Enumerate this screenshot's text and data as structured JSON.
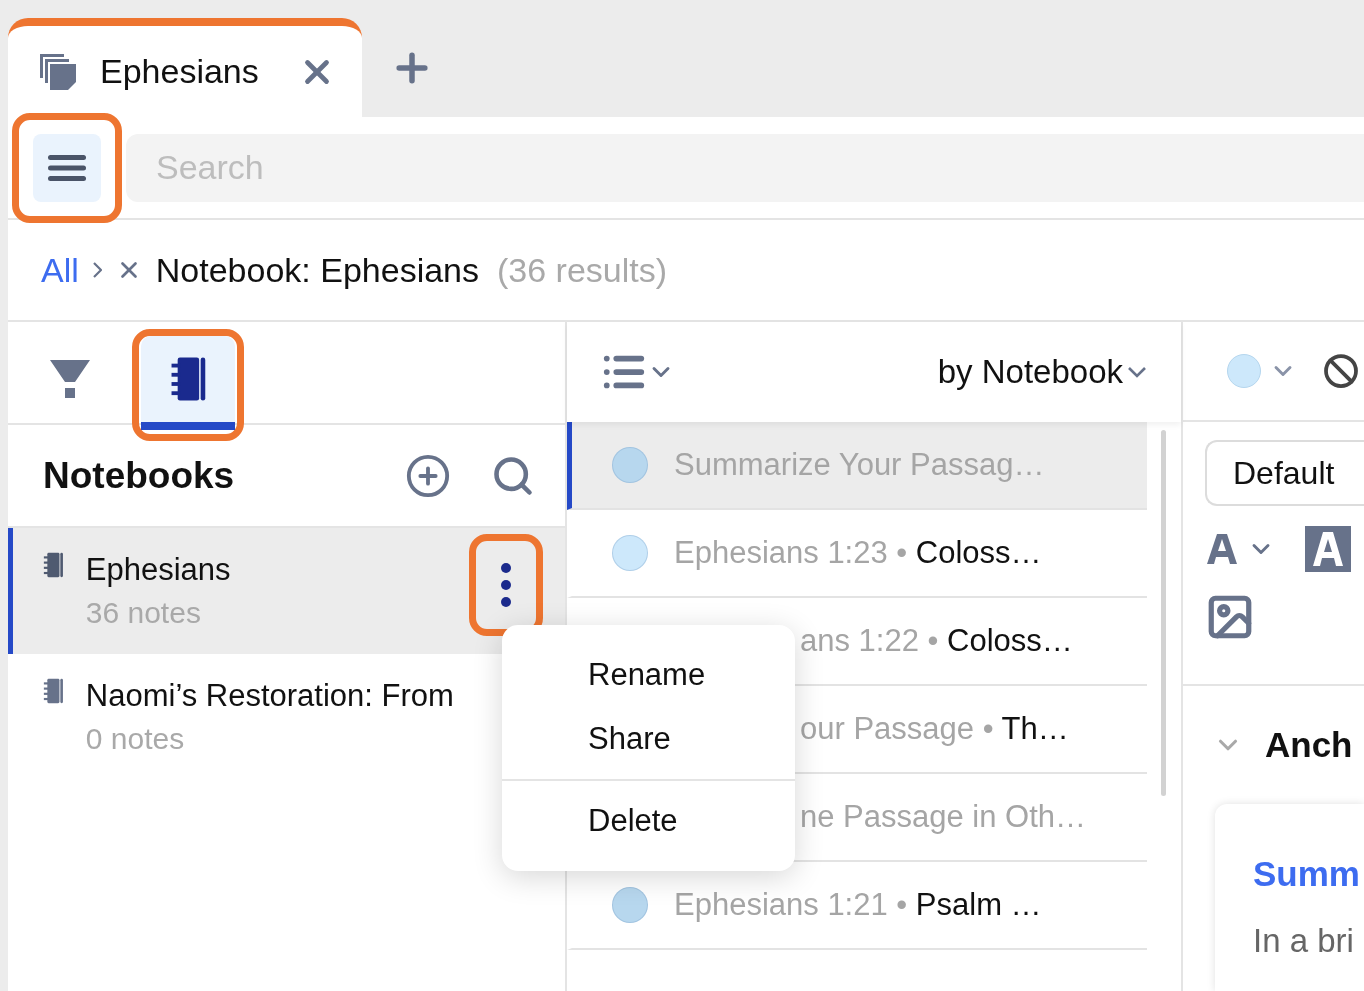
{
  "tabs": [
    {
      "title": "Ephesians",
      "selected": true,
      "highlighted": true
    }
  ],
  "menu_button": {
    "highlighted": true
  },
  "search": {
    "placeholder": "Search"
  },
  "breadcrumb": {
    "root": "All",
    "filter": "Notebook: Ephesians",
    "count": "(36 results)"
  },
  "sidebar": {
    "tabs": [
      {
        "kind": "filter",
        "selected": false,
        "highlighted": false
      },
      {
        "kind": "notebooks",
        "selected": true,
        "highlighted": true
      }
    ],
    "title": "Notebooks",
    "items": [
      {
        "name": "Ephesians",
        "count": "36 notes",
        "selected": true,
        "highlighted": true
      },
      {
        "name": "Naomi’s Restoration: From",
        "count": "0 notes",
        "selected": false
      }
    ]
  },
  "context_menu": {
    "groups": [
      [
        "Rename",
        "Share"
      ],
      [
        "Delete"
      ]
    ]
  },
  "notes": {
    "sort": "by Notebook",
    "rows": [
      {
        "kind": "full",
        "source": "Summarize Your Passag…",
        "selected": true,
        "color": "#b7d7ee"
      },
      {
        "kind": "full",
        "source": "Ephesians 1:23",
        "separator": "•",
        "title": "Coloss…",
        "selected": false,
        "color": "#cde8fb"
      },
      {
        "kind": "covered",
        "source": "ans 1:22",
        "separator": "•",
        "title": "Coloss…",
        "selected": false
      },
      {
        "kind": "covered",
        "source": "our Passage",
        "separator": "•",
        "title": "Th…",
        "selected": false
      },
      {
        "kind": "covered",
        "source": "ne Passage in Oth…",
        "selected": false
      },
      {
        "kind": "full",
        "source": "Ephesians 1:21",
        "separator": "•",
        "title": "Psalm …",
        "selected": false,
        "color": "#b7d7ee"
      }
    ]
  },
  "editor": {
    "font": "Default",
    "heading": "Anch",
    "card": {
      "title": "Summ",
      "text": "In a bri"
    }
  }
}
